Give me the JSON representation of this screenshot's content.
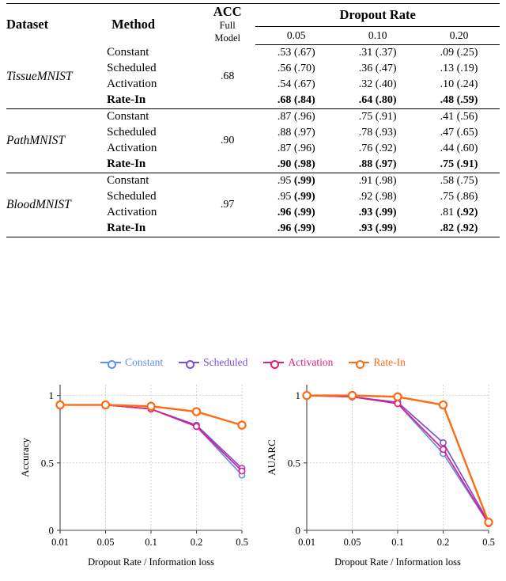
{
  "table": {
    "headers": {
      "dataset": "Dataset",
      "method": "Method",
      "acc": "ACC",
      "acc_sub1": "Full",
      "acc_sub2": "Model",
      "dropout_group": "Dropout Rate",
      "rates": [
        "0.05",
        "0.10",
        "0.20"
      ]
    },
    "groups": [
      {
        "dataset": "TissueMNIST",
        "acc": ".68",
        "rows": [
          {
            "method": "Constant",
            "bold_method": false,
            "cells": [
              {
                "v": ".53 (.67)",
                "bold": false
              },
              {
                "v": ".31 (.37)",
                "bold": false
              },
              {
                "v": ".09 (.25)",
                "bold": false
              }
            ]
          },
          {
            "method": "Scheduled",
            "bold_method": false,
            "cells": [
              {
                "v": ".56 (.70)",
                "bold": false
              },
              {
                "v": ".36 (.47)",
                "bold": false
              },
              {
                "v": ".13 (.19)",
                "bold": false
              }
            ]
          },
          {
            "method": "Activation",
            "bold_method": false,
            "cells": [
              {
                "v": ".54 (.67)",
                "bold": false
              },
              {
                "v": ".32 (.40)",
                "bold": false
              },
              {
                "v": ".10 (.24)",
                "bold": false
              }
            ]
          },
          {
            "method": "Rate-In",
            "bold_method": true,
            "cells": [
              {
                "v": ".68 (.84)",
                "bold": true
              },
              {
                "v": ".64 (.80)",
                "bold": true
              },
              {
                "v": ".48 (.59)",
                "bold": true
              }
            ]
          }
        ]
      },
      {
        "dataset": "PathMNIST",
        "acc": ".90",
        "rows": [
          {
            "method": "Constant",
            "bold_method": false,
            "cells": [
              {
                "v": ".87 (.96)",
                "bold": false
              },
              {
                "v": ".75 (.91)",
                "bold": false
              },
              {
                "v": ".41 (.56)",
                "bold": false
              }
            ]
          },
          {
            "method": "Scheduled",
            "bold_method": false,
            "cells": [
              {
                "v": ".88 (.97)",
                "bold": false
              },
              {
                "v": ".78 (.93)",
                "bold": false
              },
              {
                "v": ".47 (.65)",
                "bold": false
              }
            ]
          },
          {
            "method": "Activation",
            "bold_method": false,
            "cells": [
              {
                "v": ".87 (.96)",
                "bold": false
              },
              {
                "v": ".76 (.92)",
                "bold": false
              },
              {
                "v": ".44 (.60)",
                "bold": false
              }
            ]
          },
          {
            "method": "Rate-In",
            "bold_method": true,
            "cells": [
              {
                "v": ".90 (.98)",
                "bold": true
              },
              {
                "v": ".88 (.97)",
                "bold": true
              },
              {
                "v": ".75 (.91)",
                "bold": true
              }
            ]
          }
        ]
      },
      {
        "dataset": "BloodMNIST",
        "acc": ".97",
        "rows": [
          {
            "method": "Constant",
            "bold_method": false,
            "cells": [
              {
                "v": ".95 (.99)",
                "bold": false,
                "partial_bold": "(.99)"
              },
              {
                "v": ".91 (.98)",
                "bold": false
              },
              {
                "v": ".58 (.75)",
                "bold": false
              }
            ]
          },
          {
            "method": "Scheduled",
            "bold_method": false,
            "cells": [
              {
                "v": ".95 (.99)",
                "bold": false,
                "partial_bold": "(.99)"
              },
              {
                "v": ".92 (.98)",
                "bold": false
              },
              {
                "v": ".75 (.86)",
                "bold": false
              }
            ]
          },
          {
            "method": "Activation",
            "bold_method": false,
            "cells": [
              {
                "v": ".96 (.99)",
                "bold": true
              },
              {
                "v": ".93 (.99)",
                "bold": true
              },
              {
                "v": ".81 (.92)",
                "bold": false,
                "partial_bold": "(.92)"
              }
            ]
          },
          {
            "method": "Rate-In",
            "bold_method": true,
            "cells": [
              {
                "v": ".96 (.99)",
                "bold": true
              },
              {
                "v": ".93 (.99)",
                "bold": true
              },
              {
                "v": ".82 (.92)",
                "bold": true
              }
            ]
          }
        ]
      }
    ]
  },
  "figure": {
    "legend": [
      {
        "label": "Constant",
        "color": "#5b8ff9"
      },
      {
        "label": "Scheduled",
        "color": "#7b4ddb"
      },
      {
        "label": "Activation",
        "color": "#e8197d"
      },
      {
        "label": "Rate-In",
        "color": "#ff6a13"
      }
    ]
  },
  "chart_data": [
    {
      "type": "line",
      "title": "",
      "xlabel": "Dropout Rate / Information loss",
      "ylabel": "Accuracy",
      "x": [
        0.01,
        0.05,
        0.1,
        0.2,
        0.5
      ],
      "xticklabels": [
        "0.01",
        "0.05",
        "0.1",
        "0.2",
        "0.5"
      ],
      "yticklabels": [
        "0",
        "0.5",
        "1"
      ],
      "ylim": [
        0,
        1.08
      ],
      "grid": true,
      "legend_position": "above-figure",
      "series": [
        {
          "name": "Constant",
          "color": "#5b8ff9",
          "values": [
            0.93,
            0.93,
            0.9,
            0.77,
            0.41
          ]
        },
        {
          "name": "Scheduled",
          "color": "#7b4ddb",
          "values": [
            0.93,
            0.93,
            0.9,
            0.78,
            0.46
          ]
        },
        {
          "name": "Activation",
          "color": "#e8197d",
          "values": [
            0.93,
            0.93,
            0.9,
            0.77,
            0.44
          ]
        },
        {
          "name": "Rate-In",
          "color": "#ff6a13",
          "values": [
            0.93,
            0.93,
            0.92,
            0.88,
            0.78
          ]
        }
      ]
    },
    {
      "type": "line",
      "title": "",
      "xlabel": "Dropout Rate / Information loss",
      "ylabel": "AUARC",
      "x": [
        0.01,
        0.05,
        0.1,
        0.2,
        0.5
      ],
      "xticklabels": [
        "0.01",
        "0.05",
        "0.1",
        "0.2",
        "0.5"
      ],
      "yticklabels": [
        "0",
        "0.5",
        "1"
      ],
      "ylim": [
        0,
        1.08
      ],
      "grid": true,
      "legend_position": "above-figure",
      "series": [
        {
          "name": "Constant",
          "color": "#5b8ff9",
          "values": [
            1.0,
            0.99,
            0.94,
            0.57,
            0.05
          ]
        },
        {
          "name": "Scheduled",
          "color": "#7b4ddb",
          "values": [
            1.0,
            0.99,
            0.95,
            0.65,
            0.06
          ]
        },
        {
          "name": "Activation",
          "color": "#e8197d",
          "values": [
            1.0,
            0.99,
            0.94,
            0.6,
            0.05
          ]
        },
        {
          "name": "Rate-In",
          "color": "#ff6a13",
          "values": [
            1.0,
            1.0,
            0.99,
            0.93,
            0.06
          ]
        }
      ]
    }
  ]
}
